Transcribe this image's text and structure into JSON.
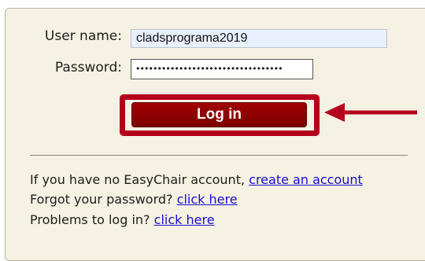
{
  "form": {
    "username_label": "User name:",
    "username_value": "cladsprograma2019",
    "password_label": "Password:",
    "password_masked": "••••••••••••••••••••••••••••••••••",
    "login_label": "Log in"
  },
  "help": {
    "no_account_text": "If you have no EasyChair account,",
    "create_account_link": "create an account",
    "forgot_text": "Forgot your password?",
    "forgot_link": "click here",
    "problems_text": "Problems to log in?",
    "problems_link": "click here"
  },
  "colors": {
    "panel_bg": "#f5f1e3",
    "button_bg": "#8b0000",
    "highlight": "#b3001b",
    "link": "#1a0dcc"
  },
  "annotations": {
    "highlight_icon": "red-rectangle-highlight",
    "arrow_icon": "red-arrow-left-icon"
  }
}
